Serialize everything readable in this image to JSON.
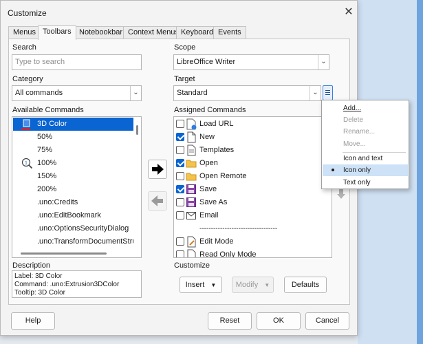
{
  "window": {
    "title": "Customize"
  },
  "tabs": [
    {
      "label": "Menus"
    },
    {
      "label": "Toolbars",
      "active": true
    },
    {
      "label": "Notebookbar"
    },
    {
      "label": "Context Menus"
    },
    {
      "label": "Keyboard"
    },
    {
      "label": "Events"
    }
  ],
  "search": {
    "label": "Search",
    "placeholder": "Type to search"
  },
  "category": {
    "label": "Category",
    "value": "All commands"
  },
  "available": {
    "label": "Available Commands",
    "items": [
      {
        "label": "3D Color",
        "icon": "3d-color-icon",
        "selected": true
      },
      {
        "label": "50%",
        "icon": ""
      },
      {
        "label": "75%",
        "icon": ""
      },
      {
        "label": "100%",
        "icon": "zoom-100-icon"
      },
      {
        "label": "150%",
        "icon": ""
      },
      {
        "label": "200%",
        "icon": ""
      },
      {
        "label": ".uno:Credits",
        "icon": ""
      },
      {
        "label": ".uno:EditBookmark",
        "icon": ""
      },
      {
        "label": ".uno:OptionsSecurityDialog",
        "icon": ""
      },
      {
        "label": ".uno:TransformDocumentStructure",
        "icon": ""
      }
    ]
  },
  "scope": {
    "label": "Scope",
    "value": "LibreOffice Writer"
  },
  "target": {
    "label": "Target",
    "value": "Standard"
  },
  "assigned": {
    "label": "Assigned Commands",
    "items": [
      {
        "label": "Load URL",
        "checked": false,
        "icon": "load-url-icon"
      },
      {
        "label": "New",
        "checked": true,
        "icon": "new-document-icon"
      },
      {
        "label": "Templates",
        "checked": false,
        "icon": "templates-icon"
      },
      {
        "label": "Open",
        "checked": true,
        "icon": "open-folder-icon"
      },
      {
        "label": "Open Remote",
        "checked": false,
        "icon": "open-remote-icon"
      },
      {
        "label": "Save",
        "checked": true,
        "icon": "save-icon"
      },
      {
        "label": "Save As",
        "checked": false,
        "icon": "save-as-icon"
      },
      {
        "label": "Email",
        "checked": false,
        "icon": "email-icon"
      },
      {
        "label": "----------------------------------",
        "separator": true
      },
      {
        "label": "Edit Mode",
        "checked": false,
        "icon": "edit-mode-icon"
      },
      {
        "label": "Read Only Mode",
        "checked": false,
        "icon": "read-only-icon"
      }
    ]
  },
  "description": {
    "label": "Description",
    "line1": "Label: 3D Color",
    "line2": "Command: .uno:Extrusion3DColor",
    "line3": "Tooltip: 3D Color"
  },
  "customize": {
    "label": "Customize",
    "insert": "Insert",
    "modify": "Modify",
    "defaults": "Defaults"
  },
  "menu": {
    "items": [
      {
        "label": "Add...",
        "enabled": true
      },
      {
        "label": "Delete",
        "enabled": false
      },
      {
        "label": "Rename...",
        "enabled": false
      },
      {
        "label": "Move...",
        "enabled": false
      },
      {
        "label": "Icon and text",
        "enabled": true
      },
      {
        "label": "Icon only",
        "enabled": true,
        "checked": true
      },
      {
        "label": "Text only",
        "enabled": true
      }
    ]
  },
  "footer": {
    "help": "Help",
    "reset": "Reset",
    "ok": "OK",
    "cancel": "Cancel"
  },
  "colors": {
    "accent": "#0a64d1",
    "selection_text": "#ffffff"
  }
}
